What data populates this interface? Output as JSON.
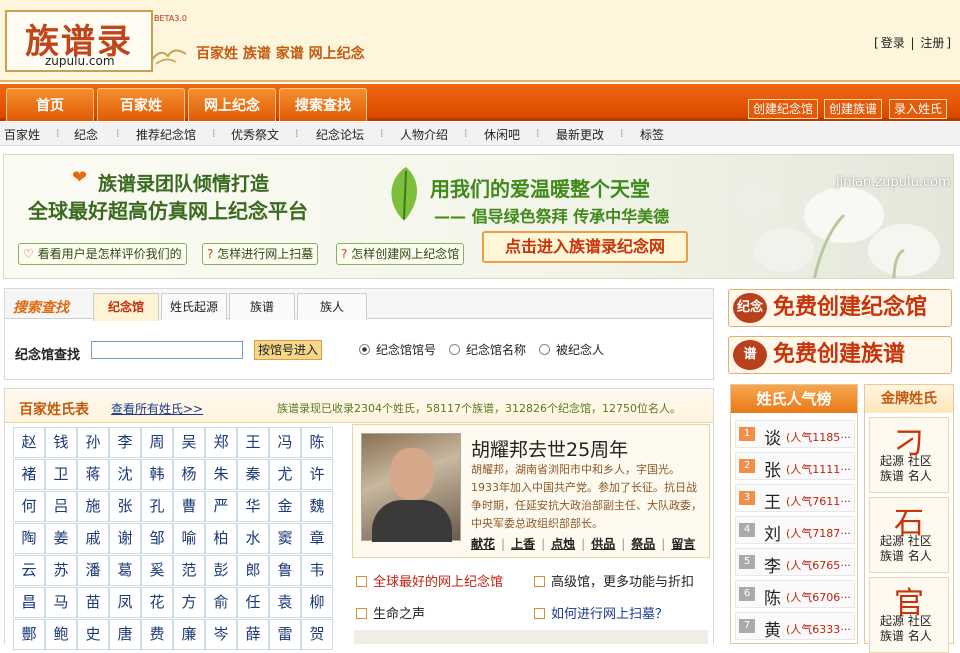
{
  "header": {
    "logo_cn": "族谱录",
    "logo_en": "zupulu.com",
    "beta": "BETA3.0",
    "tagline": "百家姓 族谱 家谱 网上纪念",
    "login": "登录",
    "register": "注册"
  },
  "nav": {
    "tabs": [
      "首页",
      "百家姓",
      "网上纪念",
      "搜索查找"
    ],
    "right_buttons": [
      "创建纪念馆",
      "创建族谱",
      "录入姓氏"
    ]
  },
  "subnav": [
    "百家姓",
    "纪念",
    "推荐纪念馆",
    "优秀祭文",
    "纪念论坛",
    "人物介绍",
    "休闲吧",
    "最新更改",
    "标签"
  ],
  "banner": {
    "line1": "族谱录团队倾情打造",
    "line2": "全球最好超高仿真网上纪念平台",
    "btn1": "看看用户是怎样评价我们的",
    "btn2": "怎样进行网上扫墓",
    "btn3": "怎样创建网上纪念馆",
    "slogan1": "用我们的爱温暖整个天堂",
    "slogan2": "—— 倡导绿色祭拜  传承中华美德",
    "cta": "点击进入族谱录纪念网",
    "domain": "jinian.zupulu.com"
  },
  "search": {
    "label": "搜索查找",
    "tabs": [
      "纪念馆",
      "姓氏起源",
      "族谱",
      "族人"
    ],
    "active_tab": "纪念馆",
    "query_label": "纪念馆查找",
    "input_value": "",
    "button": "按馆号进入",
    "options": [
      "纪念馆馆号",
      "纪念馆名称",
      "被纪念人"
    ]
  },
  "right_banners": {
    "create_memorial": "免费创建纪念馆",
    "create_genealogy": "免费创建族谱",
    "icon1": "纪念",
    "icon2": "谱"
  },
  "surnames": {
    "title": "百家姓氏表",
    "view_all": "查看所有姓氏>>",
    "stats": "族谱录现已收录2304个姓氏，58117个族谱，312826个纪念馆，12750位名人。",
    "grid": [
      [
        "赵",
        "钱",
        "孙",
        "李",
        "周",
        "吴",
        "郑",
        "王",
        "冯",
        "陈"
      ],
      [
        "褚",
        "卫",
        "蒋",
        "沈",
        "韩",
        "杨",
        "朱",
        "秦",
        "尤",
        "许"
      ],
      [
        "何",
        "吕",
        "施",
        "张",
        "孔",
        "曹",
        "严",
        "华",
        "金",
        "魏"
      ],
      [
        "陶",
        "姜",
        "戚",
        "谢",
        "邹",
        "喻",
        "柏",
        "水",
        "窦",
        "章"
      ],
      [
        "云",
        "苏",
        "潘",
        "葛",
        "奚",
        "范",
        "彭",
        "郎",
        "鲁",
        "韦"
      ],
      [
        "昌",
        "马",
        "苗",
        "凤",
        "花",
        "方",
        "俞",
        "任",
        "袁",
        "柳"
      ],
      [
        "酆",
        "鲍",
        "史",
        "唐",
        "费",
        "廉",
        "岑",
        "薛",
        "雷",
        "贺"
      ]
    ]
  },
  "news": {
    "title": "胡耀邦去世25周年",
    "body": "胡耀邦，湖南省浏阳市中和乡人，字国光。1933年加入中国共产党。参加了长征。抗日战争时期，任延安抗大政治部副主任、大队政委，中央军委总政组织部部长。",
    "actions": [
      "献花",
      "上香",
      "点烛",
      "供品",
      "祭品",
      "留言"
    ],
    "links": [
      {
        "text": "全球最好的网上纪念馆",
        "style": "red"
      },
      {
        "text": "高级馆，更多功能与折扣",
        "style": "plain"
      },
      {
        "text": "生命之声",
        "style": "plain"
      },
      {
        "text": "如何进行网上扫墓？",
        "style": "blue"
      }
    ]
  },
  "hot": {
    "title": "姓氏人气榜",
    "items": [
      {
        "rank": "1",
        "name": "谈",
        "pop": "人气1185"
      },
      {
        "rank": "2",
        "name": "张",
        "pop": "人气1111"
      },
      {
        "rank": "3",
        "name": "王",
        "pop": "人气7611"
      },
      {
        "rank": "4",
        "name": "刘",
        "pop": "人气7187"
      },
      {
        "rank": "5",
        "name": "李",
        "pop": "人气6765"
      },
      {
        "rank": "6",
        "name": "陈",
        "pop": "人气6706"
      },
      {
        "rank": "7",
        "name": "黄",
        "pop": "人气6333"
      }
    ]
  },
  "gold": {
    "title": "金牌姓氏",
    "cards": [
      {
        "char": "刁",
        "l1": "起源  社区",
        "l2": "族谱  名人"
      },
      {
        "char": "石",
        "l1": "起源  社区",
        "l2": "族谱  名人"
      },
      {
        "char": "官",
        "l1": "起源  社区",
        "l2": "族谱  名人"
      }
    ]
  },
  "colors": {
    "accent": "#e35a0a",
    "nav": "#d94700",
    "green": "#3a6a20"
  }
}
